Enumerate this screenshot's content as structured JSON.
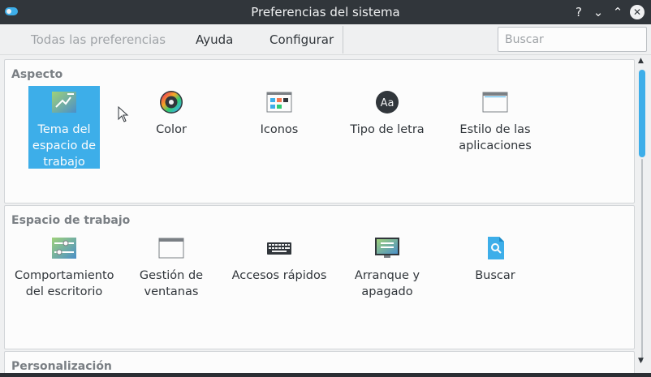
{
  "window": {
    "title": "Preferencias del sistema",
    "help_glyph": "?",
    "minimize_glyph": "⌄",
    "maximize_glyph": "⌃",
    "close_glyph": "✕"
  },
  "toolbar": {
    "all_prefs_label": "Todas las preferencias",
    "help_label": "Ayuda",
    "configure_label": "Configurar",
    "search_placeholder": "Buscar"
  },
  "sections": [
    {
      "title": "Aspecto",
      "items": [
        {
          "label_lines": [
            "Tema del",
            "espacio de",
            "trabajo"
          ],
          "icon": "workspace-theme-icon",
          "selected": true
        },
        {
          "label_lines": [
            "Color"
          ],
          "icon": "color-icon",
          "selected": false
        },
        {
          "label_lines": [
            "Iconos"
          ],
          "icon": "icons-icon",
          "selected": false
        },
        {
          "label_lines": [
            "Tipo de letra"
          ],
          "icon": "font-icon",
          "selected": false
        },
        {
          "label_lines": [
            "Estilo de las",
            "aplicaciones"
          ],
          "icon": "application-style-icon",
          "selected": false
        }
      ]
    },
    {
      "title": "Espacio de trabajo",
      "items": [
        {
          "label_lines": [
            "Comportamiento",
            "del escritorio"
          ],
          "icon": "desktop-behavior-icon",
          "selected": false
        },
        {
          "label_lines": [
            "Gestión de",
            "ventanas"
          ],
          "icon": "window-management-icon",
          "selected": false
        },
        {
          "label_lines": [
            "Accesos rápidos"
          ],
          "icon": "shortcuts-icon",
          "selected": false
        },
        {
          "label_lines": [
            "Arranque y",
            "apagado"
          ],
          "icon": "startup-shutdown-icon",
          "selected": false
        },
        {
          "label_lines": [
            "Buscar"
          ],
          "icon": "search-icon",
          "selected": false
        }
      ]
    },
    {
      "title": "Personalización",
      "items": []
    }
  ],
  "colors": {
    "accent": "#3daee9",
    "titlebar": "#31363b",
    "panel": "#fcfcfc",
    "background": "#eff0f1"
  }
}
